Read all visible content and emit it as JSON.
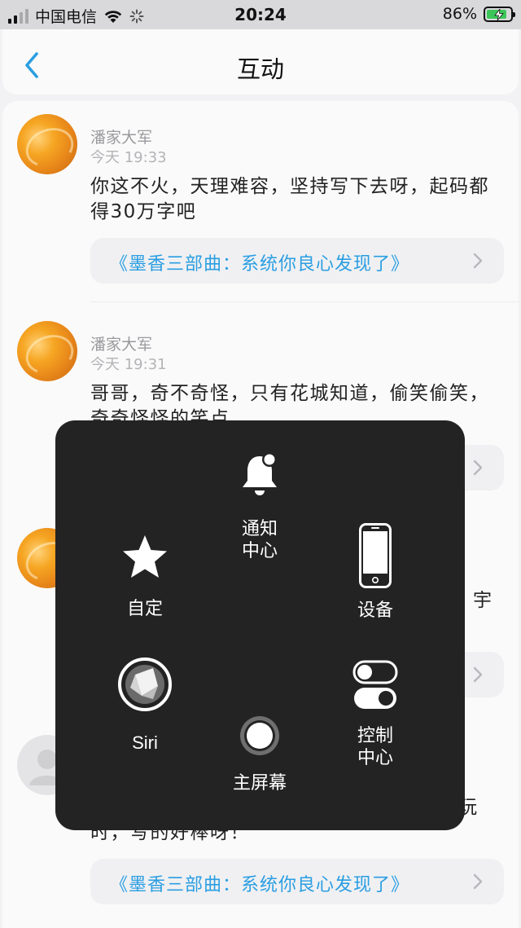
{
  "status_bar": {
    "carrier": "中国电信",
    "time": "20:24",
    "battery_percent": "86%",
    "battery_level": 0.86,
    "charging": true
  },
  "nav": {
    "title": "互动",
    "back_icon": "chevron-left-icon"
  },
  "comments": [
    {
      "user": "潘家大军",
      "time": "今天 19:33",
      "text": "你这不火，天理难容，坚持写下去呀，起码都得30万字吧",
      "link": "《墨香三部曲：系统你良心发现了》"
    },
    {
      "user": "潘家大军",
      "time": "今天 19:31",
      "text": "哥哥，奇不奇怪，只有花城知道，偷笑偷笑，奇奇怪怪的笑点"
    },
    {
      "text_tail": "宇"
    },
    {
      "text_tail_1": "玩",
      "text_tail_2": "时，写的好棒呀！",
      "link": "《墨香三部曲：系统你良心发现了》"
    }
  ],
  "assistive_touch": {
    "notification": "通知\n中心",
    "notification_l1": "通知",
    "notification_l2": "中心",
    "custom": "自定",
    "device": "设备",
    "siri": "Siri",
    "control_l1": "控制",
    "control_l2": "中心",
    "home": "主屏幕"
  },
  "colors": {
    "accent_blue": "#2a9ee2",
    "panel_bg": "#232323",
    "battery_green": "#3cc65a"
  }
}
